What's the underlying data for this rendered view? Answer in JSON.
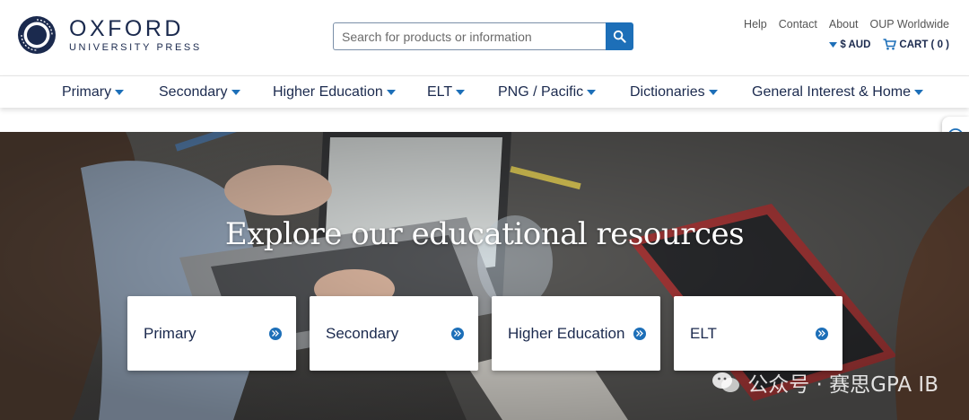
{
  "brand": {
    "name_line1": "OXFORD",
    "name_line2": "UNIVERSITY PRESS"
  },
  "search": {
    "placeholder": "Search for products or information",
    "icon": "search-icon"
  },
  "utility_links": [
    "Help",
    "Contact",
    "About",
    "OUP Worldwide"
  ],
  "store": {
    "currency": "$ AUD",
    "cart": "CART ( 0 )"
  },
  "nav": {
    "items": [
      {
        "label": "Primary"
      },
      {
        "label": "Secondary"
      },
      {
        "label": "Higher Education"
      },
      {
        "label": "ELT"
      },
      {
        "label": "PNG / Pacific"
      },
      {
        "label": "Dictionaries"
      },
      {
        "label": "General Interest & Home"
      }
    ]
  },
  "hero": {
    "title": "Explore our educational resources",
    "cards": [
      {
        "label": "Primary"
      },
      {
        "label": "Secondary"
      },
      {
        "label": "Higher Education"
      },
      {
        "label": "ELT"
      }
    ]
  },
  "watermark": "公众号 · 赛思GPA IB",
  "colors": {
    "navy": "#1b2a4e",
    "accent_blue": "#1d6fb8"
  }
}
